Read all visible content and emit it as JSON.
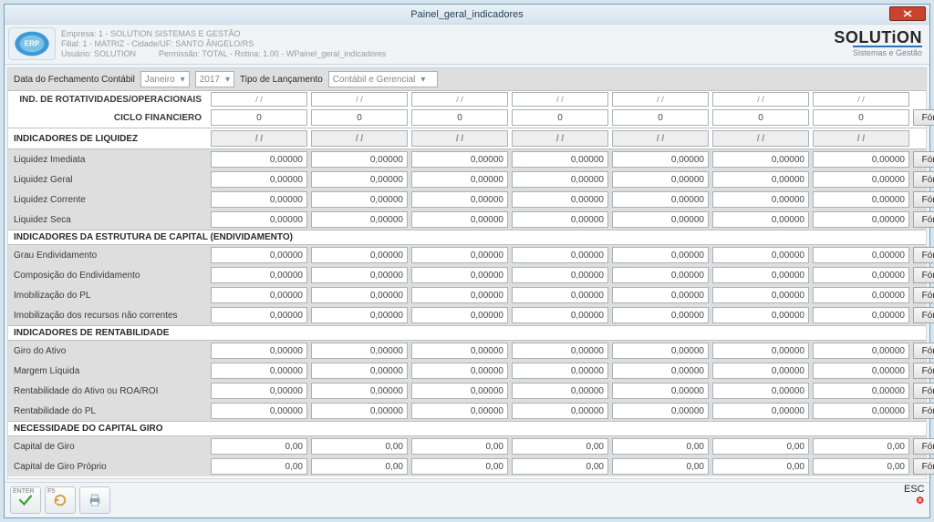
{
  "window": {
    "title": "Painel_geral_indicadores"
  },
  "meta": {
    "empresa": "Empresa: 1 - SOLUTION SISTEMAS E GESTÃO",
    "filial": "Filial: 1 - MATRIZ - Cidade/UF: SANTO ÂNGELO/RS",
    "usuario": "Usuário: SOLUTION",
    "permissao": "Permissão: TOTAL - Rotina: 1.00 - WPainel_geral_indicadores"
  },
  "brand": {
    "main": "SOLUTiON",
    "sub": "Sistemas e Gestão"
  },
  "filters": {
    "data_label": "Data do Fechamento Contábil",
    "mes": "Janeiro",
    "ano": "2017",
    "tipo_label": "Tipo de Lançamento",
    "tipo": "Contábil e Gerencial"
  },
  "labels": {
    "rotatividades": "IND. DE ROTATIVIDADES/OPERACIONAIS",
    "ciclo": "CICLO FINANCIERO",
    "formula": "Fórmula",
    "sec_liquidez": "INDICADORES DE LIQUIDEZ",
    "liq_imediata": "Liquidez Imediata",
    "liq_geral": "Liquidez Geral",
    "liq_corrente": "Liquidez Corrente",
    "liq_seca": "Liquidez Seca",
    "sec_capital": "INDICADORES DA ESTRUTURA DE CAPITAL (ENDIVIDAMENTO)",
    "grau_endiv": "Grau Endividamento",
    "comp_endiv": "Composição do Endividamento",
    "imob_pl": "Imobilização do PL",
    "imob_rec": "Imobilização dos recursos não correntes",
    "sec_rentab": "INDICADORES DE RENTABILIDADE",
    "giro_ativo": "Giro do Ativo",
    "margem_liq": "Margem Líquida",
    "rent_roa": "Rentabilidade do Ativo ou ROA/ROI",
    "rent_pl": "Rentabilidade do PL",
    "sec_ncg": "NECESSIDADE DO CAPITAL GIRO",
    "cap_giro": "Capital de Giro",
    "cap_giro_prop": "Capital de Giro Próprio"
  },
  "values": {
    "date_ph": "/  /",
    "zero": "0",
    "dec5": "0,00000",
    "dec2": "0,00"
  },
  "toolbar": {
    "enter": "ENTER",
    "f5": "F5",
    "esc": "ESC"
  }
}
